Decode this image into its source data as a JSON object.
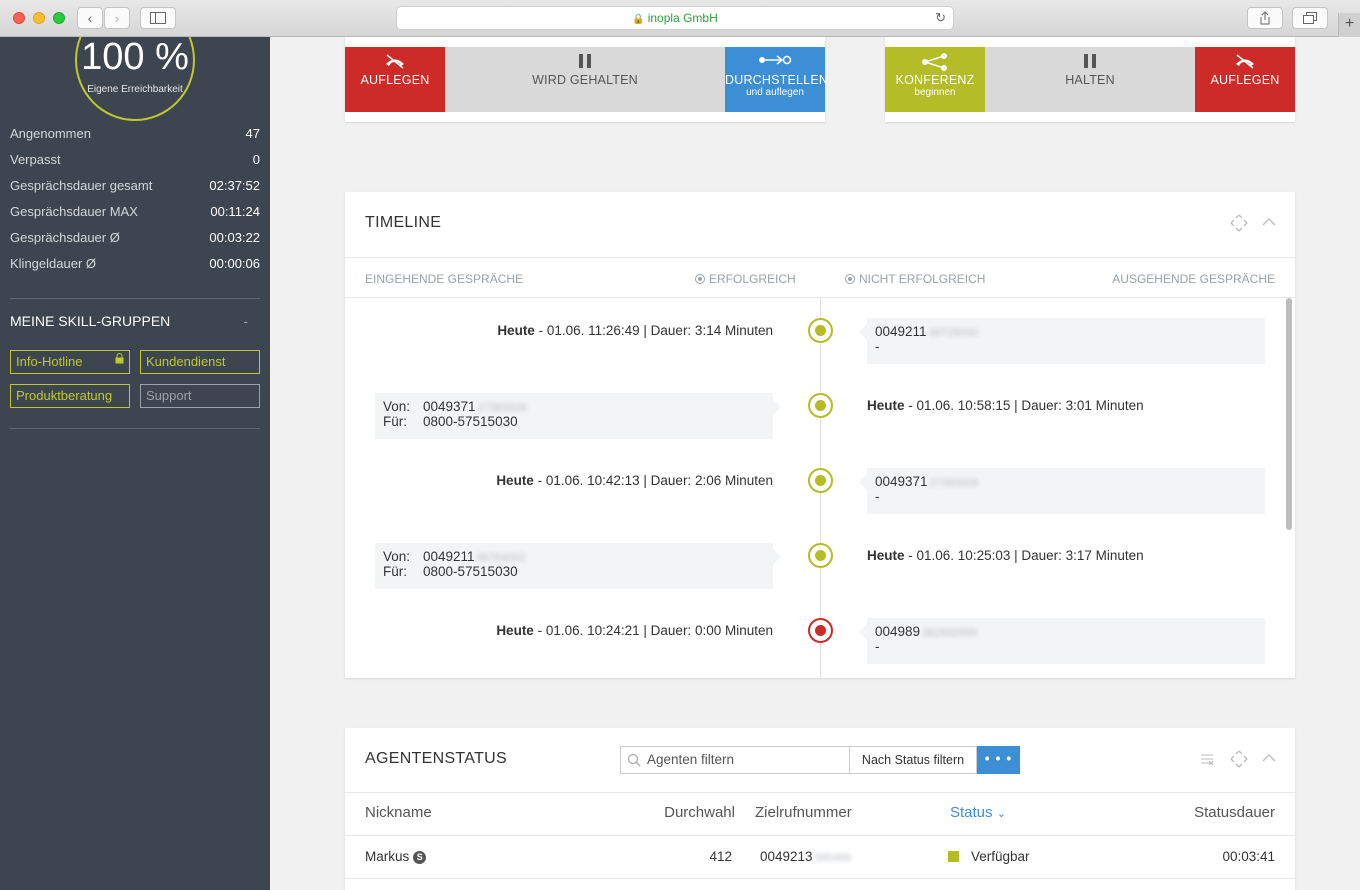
{
  "browser": {
    "url_title": "inopla GmbH",
    "new_tab": "+"
  },
  "sidebar": {
    "gauge": {
      "value": "100 %",
      "label": "Eigene Erreichbarkeit"
    },
    "stats": [
      {
        "label": "Angenommen",
        "value": "47"
      },
      {
        "label": "Verpasst",
        "value": "0"
      },
      {
        "label": "Gesprächsdauer gesamt",
        "value": "02:37:52"
      },
      {
        "label": "Gesprächsdauer MAX",
        "value": "00:11:24"
      },
      {
        "label": "Gesprächsdauer Ø",
        "value": "00:03:22"
      },
      {
        "label": "Klingeldauer Ø",
        "value": "00:00:06"
      }
    ],
    "skill_title": "MEINE SKILL-GRUPPEN",
    "skill_collapse": "-",
    "skills": [
      {
        "label": "Info-Hotline",
        "active": true,
        "locked": true
      },
      {
        "label": "Kundendienst",
        "active": true
      },
      {
        "label": "Produktberatung",
        "active": true
      },
      {
        "label": "Support",
        "active": false
      }
    ]
  },
  "call_controls": {
    "left": [
      {
        "label": "AUFLEGEN",
        "color": "#cc2b27",
        "icon": "hangup-icon"
      },
      {
        "label": "WIRD GEHALTEN",
        "color": "#d9d9d9",
        "icon": "pause-icon"
      },
      {
        "label": "DURCHSTELLEN",
        "sub": "und auflegen",
        "color": "#3c8fd4",
        "icon": "transfer-icon"
      }
    ],
    "right": [
      {
        "label": "KONFERENZ",
        "sub": "beginnen",
        "color": "#b4bc28",
        "icon": "share-icon"
      },
      {
        "label": "HALTEN",
        "color": "#d9d9d9",
        "icon": "pause-icon"
      },
      {
        "label": "AUFLEGEN",
        "color": "#cc2b27",
        "icon": "hangup-icon"
      }
    ]
  },
  "timeline": {
    "title": "TIMELINE",
    "legend": {
      "incoming": "EINGEHENDE GESPRÄCHE",
      "success": "ERFOLGREICH",
      "fail": "NICHT ERFOLGREICH",
      "outgoing": "AUSGEHENDE GESPRÄCHE"
    },
    "events": [
      {
        "day": "Heute",
        "detail": " - 01.06. 11:26:49 | Dauer: 3:14 Minuten",
        "number": "0049211",
        "hidden": "36729000",
        "line2": "-",
        "success": true
      },
      {
        "day": "Heute",
        "detail": " - 01.06. 10:58:15 | Dauer: 3:01 Minuten",
        "from_label": "Von:",
        "from": "0049371",
        "from_hidden": "27383326",
        "to_label": "Für:",
        "to": "0800-57515030",
        "success": true
      },
      {
        "day": "Heute",
        "detail": " - 01.06. 10:42:13 | Dauer: 2:06 Minuten",
        "number": "0049371",
        "hidden": "27383326",
        "line2": "-",
        "success": true
      },
      {
        "day": "Heute",
        "detail": " - 01.06. 10:25:03 | Dauer: 3:17 Minuten",
        "from_label": "Von:",
        "from": "0049211",
        "from_hidden": "36764002",
        "to_label": "Für:",
        "to": "0800-57515030",
        "success": true
      },
      {
        "day": "Heute",
        "detail": " - 01.06. 10:24:21 | Dauer: 0:00 Minuten",
        "number": "004989",
        "hidden": "382932999",
        "line2": "-",
        "success": false
      }
    ]
  },
  "agents": {
    "title": "AGENTENSTATUS",
    "filter_placeholder": "Agenten filtern",
    "status_filter": "Nach Status filtern",
    "more": "• • •",
    "columns": {
      "nickname": "Nickname",
      "durchwahl": "Durchwahl",
      "ziel": "Zielrufnummer",
      "status": "Status",
      "dauer": "Statusdauer"
    },
    "rows": [
      {
        "nickname": "Markus",
        "badge": "S",
        "durchwahl": "412",
        "ziel": "0049213",
        "ziel_hidden": "585466",
        "status": "Verfügbar",
        "status_color": "#b4bc28",
        "dauer": "00:03:41"
      }
    ]
  }
}
